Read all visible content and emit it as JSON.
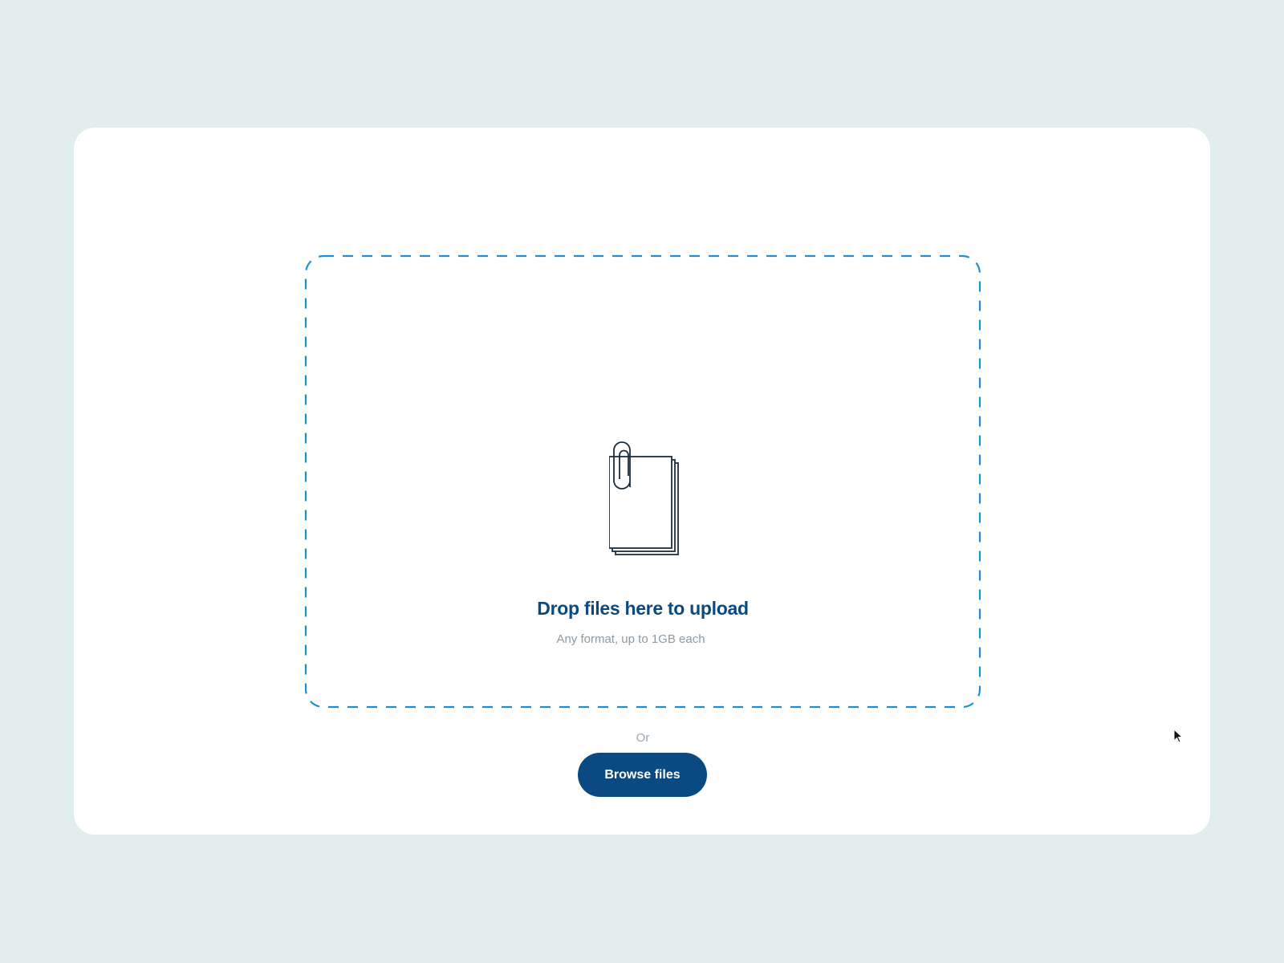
{
  "upload": {
    "icon": "paperclip-documents-icon",
    "title": "Drop files here to upload",
    "subtitle": "Any format, up to 1GB each",
    "separator": "Or",
    "browse_label": "Browse files"
  },
  "colors": {
    "background": "#e2eeee",
    "card": "#ffffff",
    "accent": "#0b4a80",
    "dash_border": "#1a90d8",
    "icon_stroke": "#1d2e3d",
    "muted_text": "#8b9ba6"
  },
  "cursor": "arrow-cursor-icon"
}
